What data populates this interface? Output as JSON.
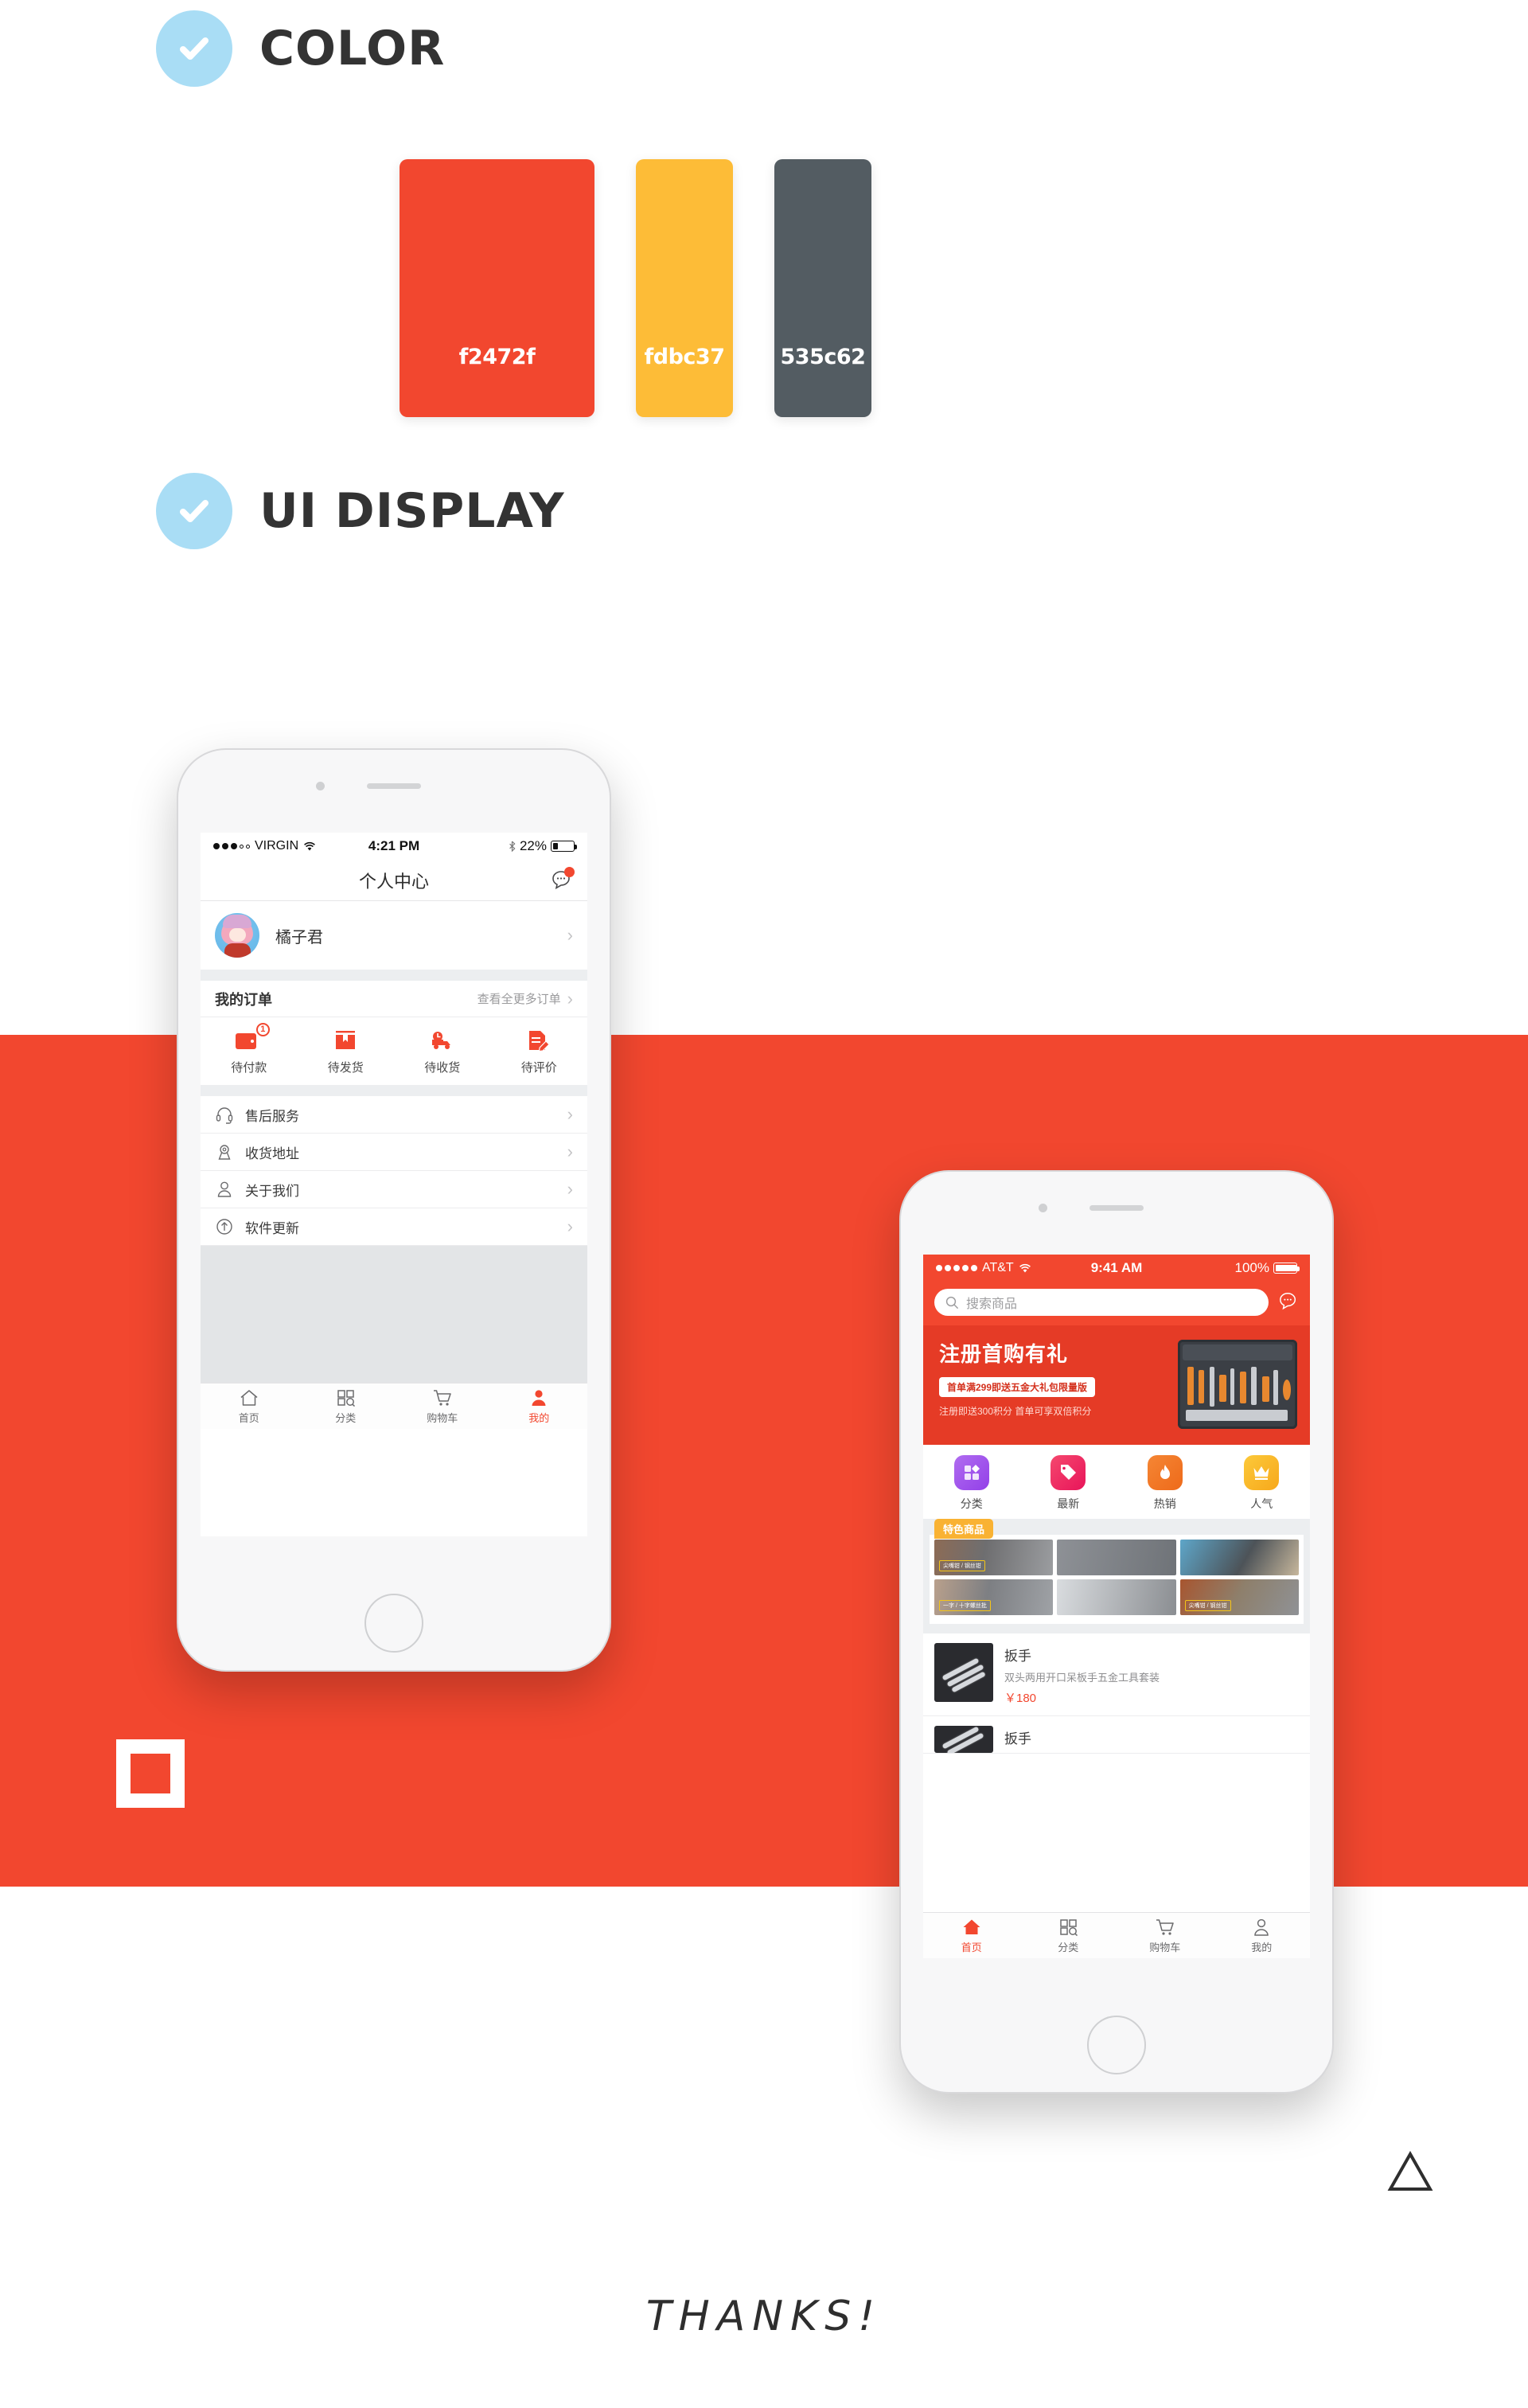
{
  "sections": {
    "color": {
      "title": "COLOR",
      "icon": "check-icon"
    },
    "ui_display": {
      "title": "UI DISPLAY",
      "icon": "check-icon"
    }
  },
  "palette": [
    {
      "hex_label": "f2472f",
      "hex": "#f2472f"
    },
    {
      "hex_label": "fdbc37",
      "hex": "#fdbc37"
    },
    {
      "hex_label": "535c62",
      "hex": "#535c62"
    }
  ],
  "accent": {
    "red": "#f2472f",
    "amber": "#fdbc37",
    "slate": "#535c62",
    "sky": "#a9ddf5"
  },
  "phone1": {
    "statusbar": {
      "carrier": "VIRGIN",
      "time": "4:21 PM",
      "battery": "22%",
      "bluetooth": "bluetooth-icon",
      "wifi": "wifi-icon"
    },
    "navbar": {
      "title": "个人中心",
      "chat_icon": "chat-bubble-icon"
    },
    "profile": {
      "name": "橘子君",
      "avatar": "user-avatar",
      "chevron": "chevron-right-icon"
    },
    "orders": {
      "title": "我的订单",
      "more": "查看全更多订单",
      "items": [
        {
          "label": "待付款",
          "icon": "wallet-icon",
          "badge": "1"
        },
        {
          "label": "待发货",
          "icon": "box-icon",
          "badge": ""
        },
        {
          "label": "待收货",
          "icon": "truck-icon",
          "badge": ""
        },
        {
          "label": "待评价",
          "icon": "review-doc-icon",
          "badge": ""
        }
      ]
    },
    "menu": [
      {
        "label": "售后服务",
        "icon": "headset-icon"
      },
      {
        "label": "收货地址",
        "icon": "location-pin-icon"
      },
      {
        "label": "关于我们",
        "icon": "person-icon"
      },
      {
        "label": "软件更新",
        "icon": "update-arrow-icon"
      }
    ],
    "tabs": [
      {
        "label": "首页",
        "icon": "home-icon",
        "active": false
      },
      {
        "label": "分类",
        "icon": "grid-search-icon",
        "active": false
      },
      {
        "label": "购物车",
        "icon": "cart-icon",
        "active": false
      },
      {
        "label": "我的",
        "icon": "person-icon",
        "active": true
      }
    ]
  },
  "phone2": {
    "statusbar": {
      "carrier": "AT&T",
      "time": "9:41 AM",
      "battery": "100%",
      "wifi": "wifi-icon"
    },
    "search": {
      "placeholder": "搜索商品",
      "icon": "search-icon",
      "chat_icon": "chat-bubble-icon"
    },
    "banner": {
      "title": "注册首购有礼",
      "pill": "首单满299即送五金大礼包限量版",
      "subtitle": "注册即送300积分 首单可享双倍积分",
      "image": "toolbox-image"
    },
    "categories": [
      {
        "label": "分类",
        "icon": "grid-icon",
        "color_a": "#b06cf0",
        "color_b": "#9340e8"
      },
      {
        "label": "最新",
        "icon": "new-tag-icon",
        "color_a": "#f5486e",
        "color_b": "#e8145a"
      },
      {
        "label": "热销",
        "icon": "flame-icon",
        "color_a": "#f58634",
        "color_b": "#ee6a1a"
      },
      {
        "label": "人气",
        "icon": "crown-icon",
        "color_a": "#fcc93a",
        "color_b": "#f7a81b"
      }
    ],
    "featured": {
      "badge": "特色商品",
      "tiles": [
        {
          "tag": "尖嘴钳 / 钢丝钳"
        },
        {
          "tag": ""
        },
        {
          "tag": ""
        },
        {
          "tag": "一字 / 十字螺丝批"
        },
        {
          "tag": "尖嘴钳 / 钢丝钳"
        },
        {
          "tag": ""
        }
      ]
    },
    "products": [
      {
        "title": "扳手",
        "desc": "双头两用开口呆板手五金工具套装",
        "price": "￥180"
      },
      {
        "title": "扳手",
        "desc": "",
        "price": ""
      }
    ],
    "tabs": [
      {
        "label": "首页",
        "icon": "home-icon",
        "active": true
      },
      {
        "label": "分类",
        "icon": "grid-search-icon",
        "active": false
      },
      {
        "label": "购物车",
        "icon": "cart-icon",
        "active": false
      },
      {
        "label": "我的",
        "icon": "person-icon",
        "active": false
      }
    ]
  },
  "footer": {
    "thanks": "THANKS!",
    "logo": "triangle-logo"
  }
}
